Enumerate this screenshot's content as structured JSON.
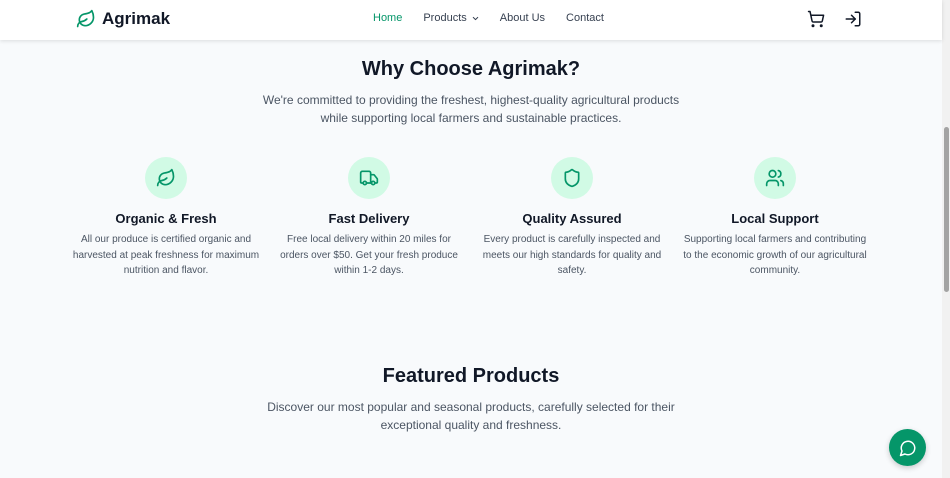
{
  "brand": {
    "name": "Agrimak",
    "logo_icon": "leaf-icon",
    "accent_color": "#059669"
  },
  "nav": {
    "home": "Home",
    "products": "Products",
    "about": "About Us",
    "contact": "Contact",
    "active": "Home"
  },
  "actions": {
    "cart_icon": "shopping-cart-icon",
    "login_icon": "log-in-icon"
  },
  "why": {
    "title": "Why Choose Agrimak?",
    "description": "We're committed to providing the freshest, highest-quality agricultural products while supporting local farmers and sustainable practices.",
    "features": [
      {
        "icon": "leaf-icon",
        "title": "Organic & Fresh",
        "description": "All our produce is certified organic and harvested at peak freshness for maximum nutrition and flavor."
      },
      {
        "icon": "truck-icon",
        "title": "Fast Delivery",
        "description": "Free local delivery within 20 miles for orders over $50. Get your fresh produce within 1-2 days."
      },
      {
        "icon": "shield-icon",
        "title": "Quality Assured",
        "description": "Every product is carefully inspected and meets our high standards for quality and safety."
      },
      {
        "icon": "users-icon",
        "title": "Local Support",
        "description": "Supporting local farmers and contributing to the economic growth of our agricultural community."
      }
    ]
  },
  "featured": {
    "title": "Featured Products",
    "description": "Discover our most popular and seasonal products, carefully selected for their exceptional quality and freshness."
  },
  "chat": {
    "icon": "chat-bubble-icon"
  }
}
